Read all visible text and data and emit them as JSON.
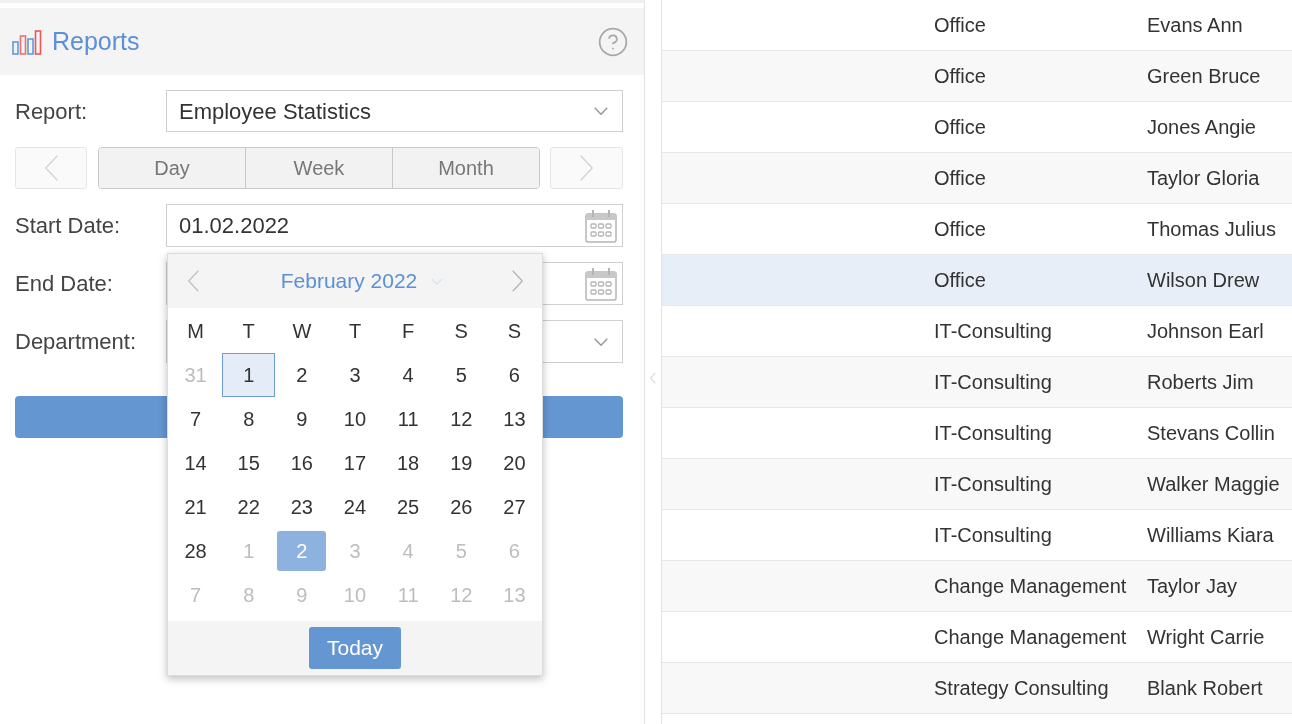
{
  "panel": {
    "title": "Reports"
  },
  "form": {
    "report": {
      "label": "Report:",
      "value": "Employee Statistics"
    },
    "period_nav": {
      "prev": {
        "disabled": true
      },
      "segments": [
        {
          "label": "Day",
          "selected": false
        },
        {
          "label": "Week",
          "selected": false
        },
        {
          "label": "Month",
          "selected": false
        }
      ],
      "next": {
        "disabled": true
      }
    },
    "start_date": {
      "label": "Start Date:",
      "value": "01.02.2022"
    },
    "end_date": {
      "label": "End Date:"
    },
    "department": {
      "label": "Department:"
    }
  },
  "date_picker": {
    "title": "February 2022",
    "weekdays": [
      "M",
      "T",
      "W",
      "T",
      "F",
      "S",
      "S"
    ],
    "weeks": [
      [
        {
          "text": "31",
          "other_month": true,
          "selected": false,
          "today": false
        },
        {
          "text": "1",
          "other_month": false,
          "selected": true,
          "today": false
        },
        {
          "text": "2",
          "other_month": false,
          "selected": false,
          "today": false
        },
        {
          "text": "3",
          "other_month": false,
          "selected": false,
          "today": false
        },
        {
          "text": "4",
          "other_month": false,
          "selected": false,
          "today": false
        },
        {
          "text": "5",
          "other_month": false,
          "selected": false,
          "today": false
        },
        {
          "text": "6",
          "other_month": false,
          "selected": false,
          "today": false
        }
      ],
      [
        {
          "text": "7",
          "other_month": false,
          "selected": false,
          "today": false
        },
        {
          "text": "8",
          "other_month": false,
          "selected": false,
          "today": false
        },
        {
          "text": "9",
          "other_month": false,
          "selected": false,
          "today": false
        },
        {
          "text": "10",
          "other_month": false,
          "selected": false,
          "today": false
        },
        {
          "text": "11",
          "other_month": false,
          "selected": false,
          "today": false
        },
        {
          "text": "12",
          "other_month": false,
          "selected": false,
          "today": false
        },
        {
          "text": "13",
          "other_month": false,
          "selected": false,
          "today": false
        }
      ],
      [
        {
          "text": "14",
          "other_month": false,
          "selected": false,
          "today": false
        },
        {
          "text": "15",
          "other_month": false,
          "selected": false,
          "today": false
        },
        {
          "text": "16",
          "other_month": false,
          "selected": false,
          "today": false
        },
        {
          "text": "17",
          "other_month": false,
          "selected": false,
          "today": false
        },
        {
          "text": "18",
          "other_month": false,
          "selected": false,
          "today": false
        },
        {
          "text": "19",
          "other_month": false,
          "selected": false,
          "today": false
        },
        {
          "text": "20",
          "other_month": false,
          "selected": false,
          "today": false
        }
      ],
      [
        {
          "text": "21",
          "other_month": false,
          "selected": false,
          "today": false
        },
        {
          "text": "22",
          "other_month": false,
          "selected": false,
          "today": false
        },
        {
          "text": "23",
          "other_month": false,
          "selected": false,
          "today": false
        },
        {
          "text": "24",
          "other_month": false,
          "selected": false,
          "today": false
        },
        {
          "text": "25",
          "other_month": false,
          "selected": false,
          "today": false
        },
        {
          "text": "26",
          "other_month": false,
          "selected": false,
          "today": false
        },
        {
          "text": "27",
          "other_month": false,
          "selected": false,
          "today": false
        }
      ],
      [
        {
          "text": "28",
          "other_month": false,
          "selected": false,
          "today": false
        },
        {
          "text": "1",
          "other_month": true,
          "selected": false,
          "today": false
        },
        {
          "text": "2",
          "other_month": true,
          "selected": false,
          "today": true
        },
        {
          "text": "3",
          "other_month": true,
          "selected": false,
          "today": false
        },
        {
          "text": "4",
          "other_month": true,
          "selected": false,
          "today": false
        },
        {
          "text": "5",
          "other_month": true,
          "selected": false,
          "today": false
        },
        {
          "text": "6",
          "other_month": true,
          "selected": false,
          "today": false
        }
      ],
      [
        {
          "text": "7",
          "other_month": true,
          "selected": false,
          "today": false
        },
        {
          "text": "8",
          "other_month": true,
          "selected": false,
          "today": false
        },
        {
          "text": "9",
          "other_month": true,
          "selected": false,
          "today": false
        },
        {
          "text": "10",
          "other_month": true,
          "selected": false,
          "today": false
        },
        {
          "text": "11",
          "other_month": true,
          "selected": false,
          "today": false
        },
        {
          "text": "12",
          "other_month": true,
          "selected": false,
          "today": false
        },
        {
          "text": "13",
          "other_month": true,
          "selected": false,
          "today": false
        }
      ]
    ],
    "today_button": "Today"
  },
  "table": {
    "rows": [
      {
        "column_1": "Office",
        "column_2": "Evans Ann",
        "selected": false
      },
      {
        "column_1": "Office",
        "column_2": "Green Bruce",
        "selected": false
      },
      {
        "column_1": "Office",
        "column_2": "Jones Angie",
        "selected": false
      },
      {
        "column_1": "Office",
        "column_2": "Taylor Gloria",
        "selected": false
      },
      {
        "column_1": "Office",
        "column_2": "Thomas Julius",
        "selected": false
      },
      {
        "column_1": "Office",
        "column_2": "Wilson Drew",
        "selected": true
      },
      {
        "column_1": "IT-Consulting",
        "column_2": "Johnson Earl",
        "selected": false
      },
      {
        "column_1": "IT-Consulting",
        "column_2": "Roberts Jim",
        "selected": false
      },
      {
        "column_1": "IT-Consulting",
        "column_2": "Stevans Collin",
        "selected": false
      },
      {
        "column_1": "IT-Consulting",
        "column_2": "Walker Maggie",
        "selected": false
      },
      {
        "column_1": "IT-Consulting",
        "column_2": "Williams Kiara",
        "selected": false
      },
      {
        "column_1": "Change Management",
        "column_2": "Taylor Jay",
        "selected": false
      },
      {
        "column_1": "Change Management",
        "column_2": "Wright Carrie",
        "selected": false
      },
      {
        "column_1": "Strategy Consulting",
        "column_2": "Blank Robert",
        "selected": false
      }
    ]
  }
}
